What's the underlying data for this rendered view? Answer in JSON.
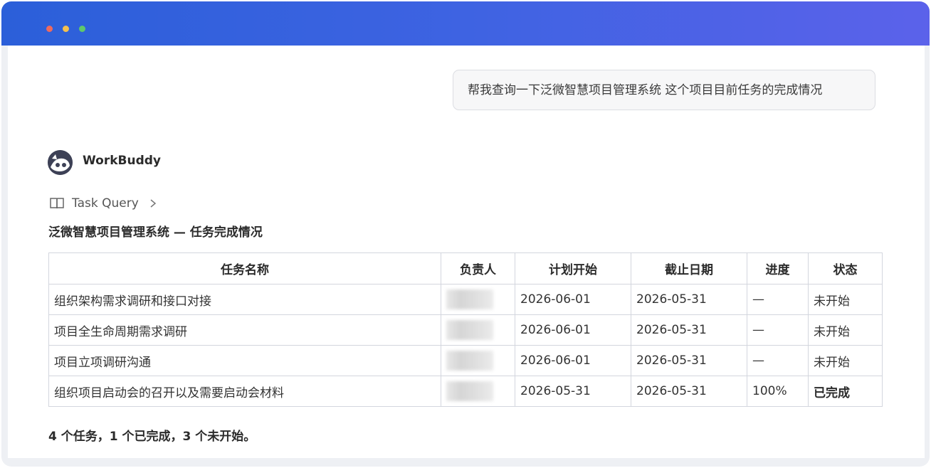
{
  "window": {
    "colors": {
      "titlebar_start": "#2b5fd9",
      "titlebar_end": "#5b62ea"
    }
  },
  "user_message": "帮我查询一下泛微智慧项目管理系统 这个项目目前任务的完成情况",
  "assistant": {
    "name": "WorkBuddy",
    "tool": {
      "label": "Task Query",
      "icon": "book-icon",
      "chevron": "chevron-right-icon"
    },
    "title": "泛微智慧项目管理系统 — 任务完成情况",
    "table": {
      "headers": [
        "任务名称",
        "负责人",
        "计划开始",
        "截止日期",
        "进度",
        "状态"
      ],
      "rows": [
        {
          "name": "组织架构需求调研和接口对接",
          "owner_redacted": true,
          "start": "2026-06-01",
          "due": "2026-05-31",
          "progress": "—",
          "status": "未开始"
        },
        {
          "name": "项目全生命周期需求调研",
          "owner_redacted": true,
          "start": "2026-06-01",
          "due": "2026-05-31",
          "progress": "—",
          "status": "未开始"
        },
        {
          "name": "项目立项调研沟通",
          "owner_redacted": true,
          "start": "2026-06-01",
          "due": "2026-05-31",
          "progress": "—",
          "status": "未开始"
        },
        {
          "name": "组织项目启动会的召开以及需要启动会材料",
          "owner_redacted": true,
          "start": "2026-05-31",
          "due": "2026-05-31",
          "progress": "100%",
          "status": "已完成"
        }
      ]
    },
    "summary": "4 个任务，1 个已完成，3 个未开始。"
  }
}
